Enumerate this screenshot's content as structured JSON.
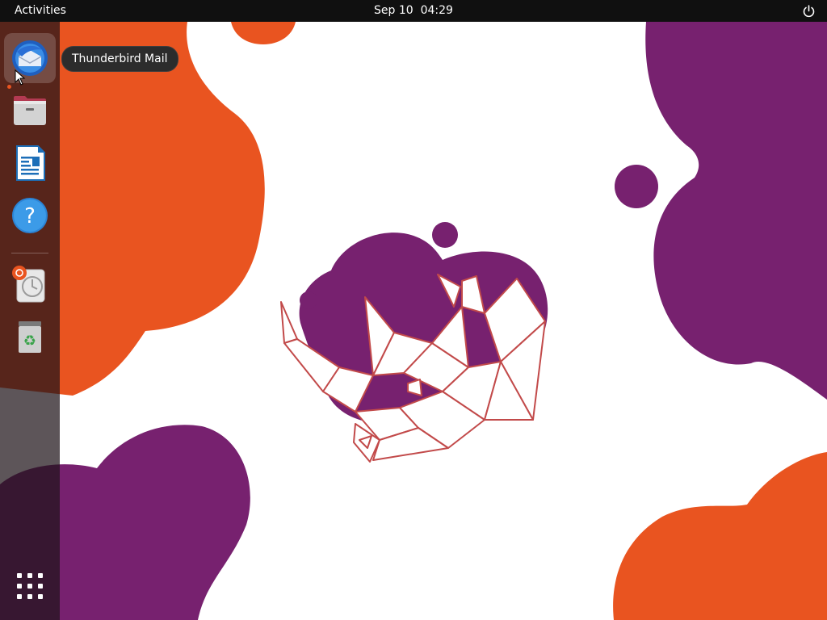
{
  "topbar": {
    "activities_label": "Activities",
    "clock_date": "Sep 10",
    "clock_time": "04:29",
    "power_icon": "power-icon"
  },
  "dock": {
    "items": [
      {
        "name": "Thunderbird Mail",
        "icon": "thunderbird-icon",
        "active": true
      },
      {
        "name": "Files",
        "icon": "files-icon"
      },
      {
        "name": "LibreOffice Writer",
        "icon": "writer-icon"
      },
      {
        "name": "Help",
        "icon": "help-icon"
      },
      {
        "name": "Ubuntu Software Updater",
        "icon": "software-icon"
      },
      {
        "name": "Trash",
        "icon": "trash-icon"
      }
    ],
    "app_grid_icon": "app-grid-icon"
  },
  "tooltip": {
    "text": "Thunderbird Mail"
  },
  "colors": {
    "orange": "#e95420",
    "purple": "#77216f",
    "topbar": "#101010"
  }
}
